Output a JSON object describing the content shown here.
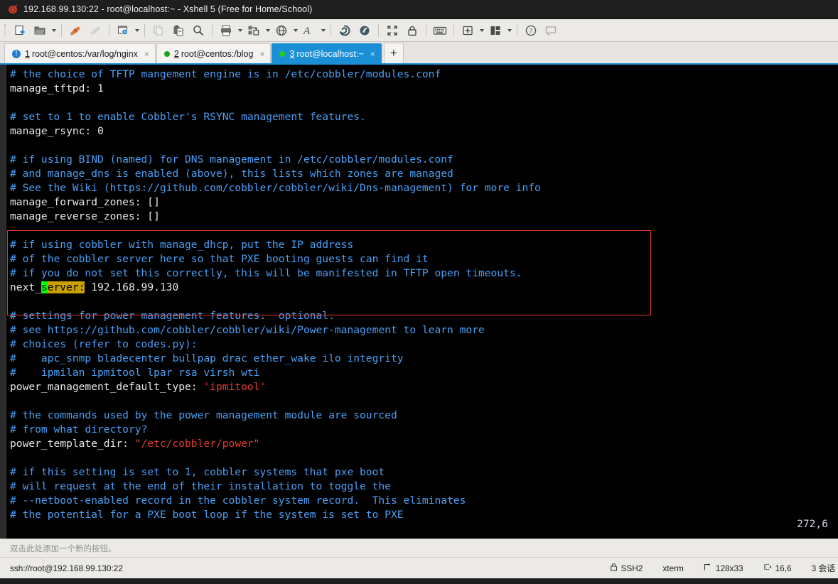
{
  "window": {
    "title": "192.168.99.130:22 - root@localhost:~ - Xshell 5 (Free for Home/School)",
    "app_icon": "xshell-shell-icon"
  },
  "toolbar": {
    "groups": [
      {
        "buttons": [
          {
            "name": "new-session-button",
            "icon": "new-file-icon",
            "caret": false
          },
          {
            "name": "open-session-button",
            "icon": "open-folder-icon",
            "caret": true
          }
        ]
      },
      {
        "buttons": [
          {
            "name": "connect-button",
            "icon": "plug-connect-icon",
            "caret": false
          },
          {
            "name": "disconnect-button",
            "icon": "plug-disconnect-icon",
            "caret": false
          }
        ]
      },
      {
        "buttons": [
          {
            "name": "session-properties-button",
            "icon": "properties-gear-icon",
            "caret": true
          }
        ]
      },
      {
        "buttons": [
          {
            "name": "copy-button",
            "icon": "copy-icon",
            "caret": false
          },
          {
            "name": "paste-button",
            "icon": "paste-icon",
            "caret": false
          },
          {
            "name": "find-button",
            "icon": "search-magnifier-icon",
            "caret": false
          }
        ]
      },
      {
        "buttons": [
          {
            "name": "print-button",
            "icon": "printer-icon",
            "caret": true
          },
          {
            "name": "file-transfer-button",
            "icon": "file-transfer-icon",
            "caret": true
          },
          {
            "name": "web-browser-button",
            "icon": "globe-icon",
            "caret": true
          },
          {
            "name": "font-button",
            "icon": "font-a-icon",
            "caret": true
          }
        ]
      },
      {
        "buttons": [
          {
            "name": "xftp-button",
            "icon": "xftp-spiral-icon",
            "caret": false
          },
          {
            "name": "xagent-button",
            "icon": "xagent-icon",
            "caret": false
          }
        ]
      },
      {
        "buttons": [
          {
            "name": "fullscreen-button",
            "icon": "fullscreen-arrows-icon",
            "caret": false
          },
          {
            "name": "lock-button",
            "icon": "lock-icon",
            "caret": false
          }
        ]
      },
      {
        "buttons": [
          {
            "name": "compose-bar-button",
            "icon": "keyboard-icon",
            "caret": false
          }
        ]
      },
      {
        "buttons": [
          {
            "name": "add-pane-button",
            "icon": "add-box-icon",
            "caret": true
          },
          {
            "name": "arrange-layout-button",
            "icon": "layout-columns-icon",
            "caret": true
          }
        ]
      },
      {
        "buttons": [
          {
            "name": "help-button",
            "icon": "question-circle-icon",
            "caret": false
          },
          {
            "name": "feedback-button",
            "icon": "chat-bubble-icon",
            "caret": false
          }
        ]
      }
    ]
  },
  "tabs": {
    "items": [
      {
        "number": "1",
        "label": "root@centos:/var/log/nginx",
        "status": "warning",
        "active": false,
        "close": "×"
      },
      {
        "number": "2",
        "label": "root@centos:/blog",
        "status": "connected",
        "active": false,
        "close": "×"
      },
      {
        "number": "3",
        "label": "root@localhost:~",
        "status": "connected",
        "active": true,
        "close": "×"
      }
    ],
    "new_tab_label": "+"
  },
  "terminal": {
    "cursor_position": "272,6",
    "highlight_box": {
      "visible": true,
      "color": "#e8352a"
    },
    "lines": [
      {
        "segments": [
          {
            "t": "# the choice of TFTP mangement engine is in /etc/cobbler/modules.conf",
            "c": "comment"
          }
        ]
      },
      {
        "segments": [
          {
            "t": "manage_tftpd: 1",
            "c": "key"
          }
        ]
      },
      {
        "segments": [
          {
            "t": "",
            "c": "key"
          }
        ]
      },
      {
        "segments": [
          {
            "t": "# set to 1 to enable Cobbler's RSYNC management features.",
            "c": "comment"
          }
        ]
      },
      {
        "segments": [
          {
            "t": "manage_rsync: 0",
            "c": "key"
          }
        ]
      },
      {
        "segments": [
          {
            "t": "",
            "c": "key"
          }
        ]
      },
      {
        "segments": [
          {
            "t": "# if using BIND (named) for DNS management in /etc/cobbler/modules.conf",
            "c": "comment"
          }
        ]
      },
      {
        "segments": [
          {
            "t": "# and manage_dns is enabled (above), this lists which zones are managed",
            "c": "comment"
          }
        ]
      },
      {
        "segments": [
          {
            "t": "# See the Wiki (https://github.com/cobbler/cobbler/wiki/Dns-management) for more info",
            "c": "comment"
          }
        ]
      },
      {
        "segments": [
          {
            "t": "manage_forward_zones: []",
            "c": "key"
          }
        ]
      },
      {
        "segments": [
          {
            "t": "manage_reverse_zones: []",
            "c": "key"
          }
        ]
      },
      {
        "segments": [
          {
            "t": "",
            "c": "key"
          }
        ]
      },
      {
        "segments": [
          {
            "t": "# if using cobbler with manage_dhcp, put the IP address",
            "c": "comment"
          }
        ]
      },
      {
        "segments": [
          {
            "t": "# of the cobbler server here so that PXE booting guests can find it",
            "c": "comment"
          }
        ]
      },
      {
        "segments": [
          {
            "t": "# if you do not set this correctly, this will be manifested in TFTP open timeouts.",
            "c": "comment"
          }
        ]
      },
      {
        "segments": [
          {
            "t": "next_",
            "c": "key"
          },
          {
            "t": "s",
            "c": "cursor"
          },
          {
            "t": "erver:",
            "c": "hl"
          },
          {
            "t": " 192.168.99.130",
            "c": "key"
          }
        ]
      },
      {
        "segments": [
          {
            "t": "",
            "c": "key"
          }
        ]
      },
      {
        "segments": [
          {
            "t": "# settings for power management features.  optional.",
            "c": "comment"
          }
        ]
      },
      {
        "segments": [
          {
            "t": "# see https://github.com/cobbler/cobbler/wiki/Power-management to learn more",
            "c": "comment"
          }
        ]
      },
      {
        "segments": [
          {
            "t": "# choices (refer to codes.py):",
            "c": "comment"
          }
        ]
      },
      {
        "segments": [
          {
            "t": "#    apc_snmp bladecenter bullpap drac ether_wake ilo integrity",
            "c": "comment"
          }
        ]
      },
      {
        "segments": [
          {
            "t": "#    ipmilan ipmitool lpar rsa virsh wti",
            "c": "comment"
          }
        ]
      },
      {
        "segments": [
          {
            "t": "power_management_default_type: ",
            "c": "key"
          },
          {
            "t": "'ipmitool'",
            "c": "str"
          }
        ]
      },
      {
        "segments": [
          {
            "t": "",
            "c": "key"
          }
        ]
      },
      {
        "segments": [
          {
            "t": "# the commands used by the power management module are sourced",
            "c": "comment"
          }
        ]
      },
      {
        "segments": [
          {
            "t": "# from what directory?",
            "c": "comment"
          }
        ]
      },
      {
        "segments": [
          {
            "t": "power_template_dir: ",
            "c": "key"
          },
          {
            "t": "\"/etc/cobbler/power\"",
            "c": "str"
          }
        ]
      },
      {
        "segments": [
          {
            "t": "",
            "c": "key"
          }
        ]
      },
      {
        "segments": [
          {
            "t": "# if this setting is set to 1, cobbler systems that pxe boot",
            "c": "comment"
          }
        ]
      },
      {
        "segments": [
          {
            "t": "# will request at the end of their installation to toggle the",
            "c": "comment"
          }
        ]
      },
      {
        "segments": [
          {
            "t": "# --netboot-enabled record in the cobbler system record.  This eliminates",
            "c": "comment"
          }
        ]
      },
      {
        "segments": [
          {
            "t": "# the potential for a PXE boot loop if the system is set to PXE",
            "c": "comment"
          }
        ]
      }
    ]
  },
  "quickbar": {
    "hint": "双击此处添加一个新的按钮。"
  },
  "statusbar": {
    "url": "ssh://root@192.168.99.130:22",
    "protocol": "SSH2",
    "protocol_icon": "lock-icon",
    "terminal_type": "xterm",
    "size": "128x33",
    "size_icon": "resize-icon",
    "cursor": "16,6",
    "cursor_icon": "cursor-pos-icon",
    "sessions": "3 会话"
  },
  "colors": {
    "accent": "#1b8fd6",
    "comment": "#4a9ff5",
    "string": "#e03c2e",
    "cursor_bg": "#00ff00",
    "highlight_bg": "#c8a000",
    "box_border": "#e8352a",
    "terminal_bg": "#000000",
    "chrome_bg": "#eceae6"
  }
}
